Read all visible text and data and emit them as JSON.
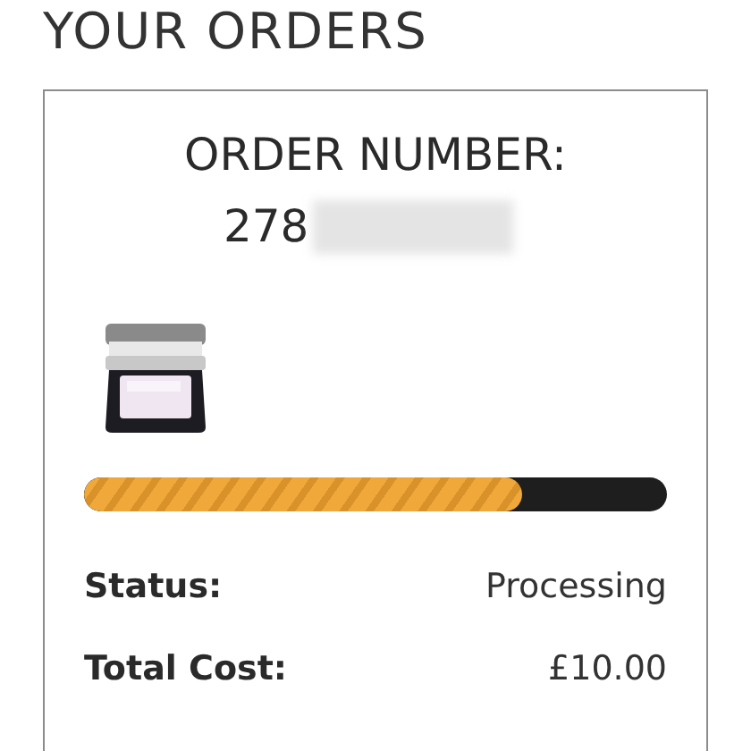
{
  "page_title": "YOUR ORDERS",
  "order": {
    "title": "ORDER NUMBER:",
    "number": "278",
    "progress": {
      "level": 0.75
    },
    "details": [
      {
        "label": "Status:",
        "value": "Processing"
      },
      {
        "label": "Total Cost:",
        "value": "£10.00"
      }
    ]
  }
}
